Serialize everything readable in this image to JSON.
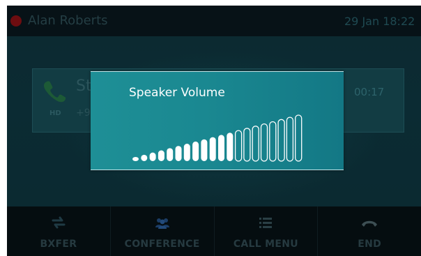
{
  "status_bar": {
    "user_name": "Alan Roberts",
    "datetime": "29 Jan 18:22",
    "status_color": "#6d0d10"
  },
  "call": {
    "caller_name": "St",
    "caller_number": "+9",
    "hd_badge": "HD",
    "duration": "00:17",
    "icon": "phone-icon"
  },
  "volume_popup": {
    "title": "Speaker Volume",
    "level": 12,
    "max_level": 20
  },
  "softkeys": [
    {
      "label": "BXFER",
      "icon": "transfer-icon"
    },
    {
      "label": "CONFERENCE",
      "icon": "conference-icon"
    },
    {
      "label": "CALL MENU",
      "icon": "menu-icon"
    },
    {
      "label": "END",
      "icon": "end-call-icon"
    }
  ],
  "colors": {
    "popup": "#1a8891",
    "screen_bg": "#04181d",
    "softkey_text": "#263a40"
  }
}
